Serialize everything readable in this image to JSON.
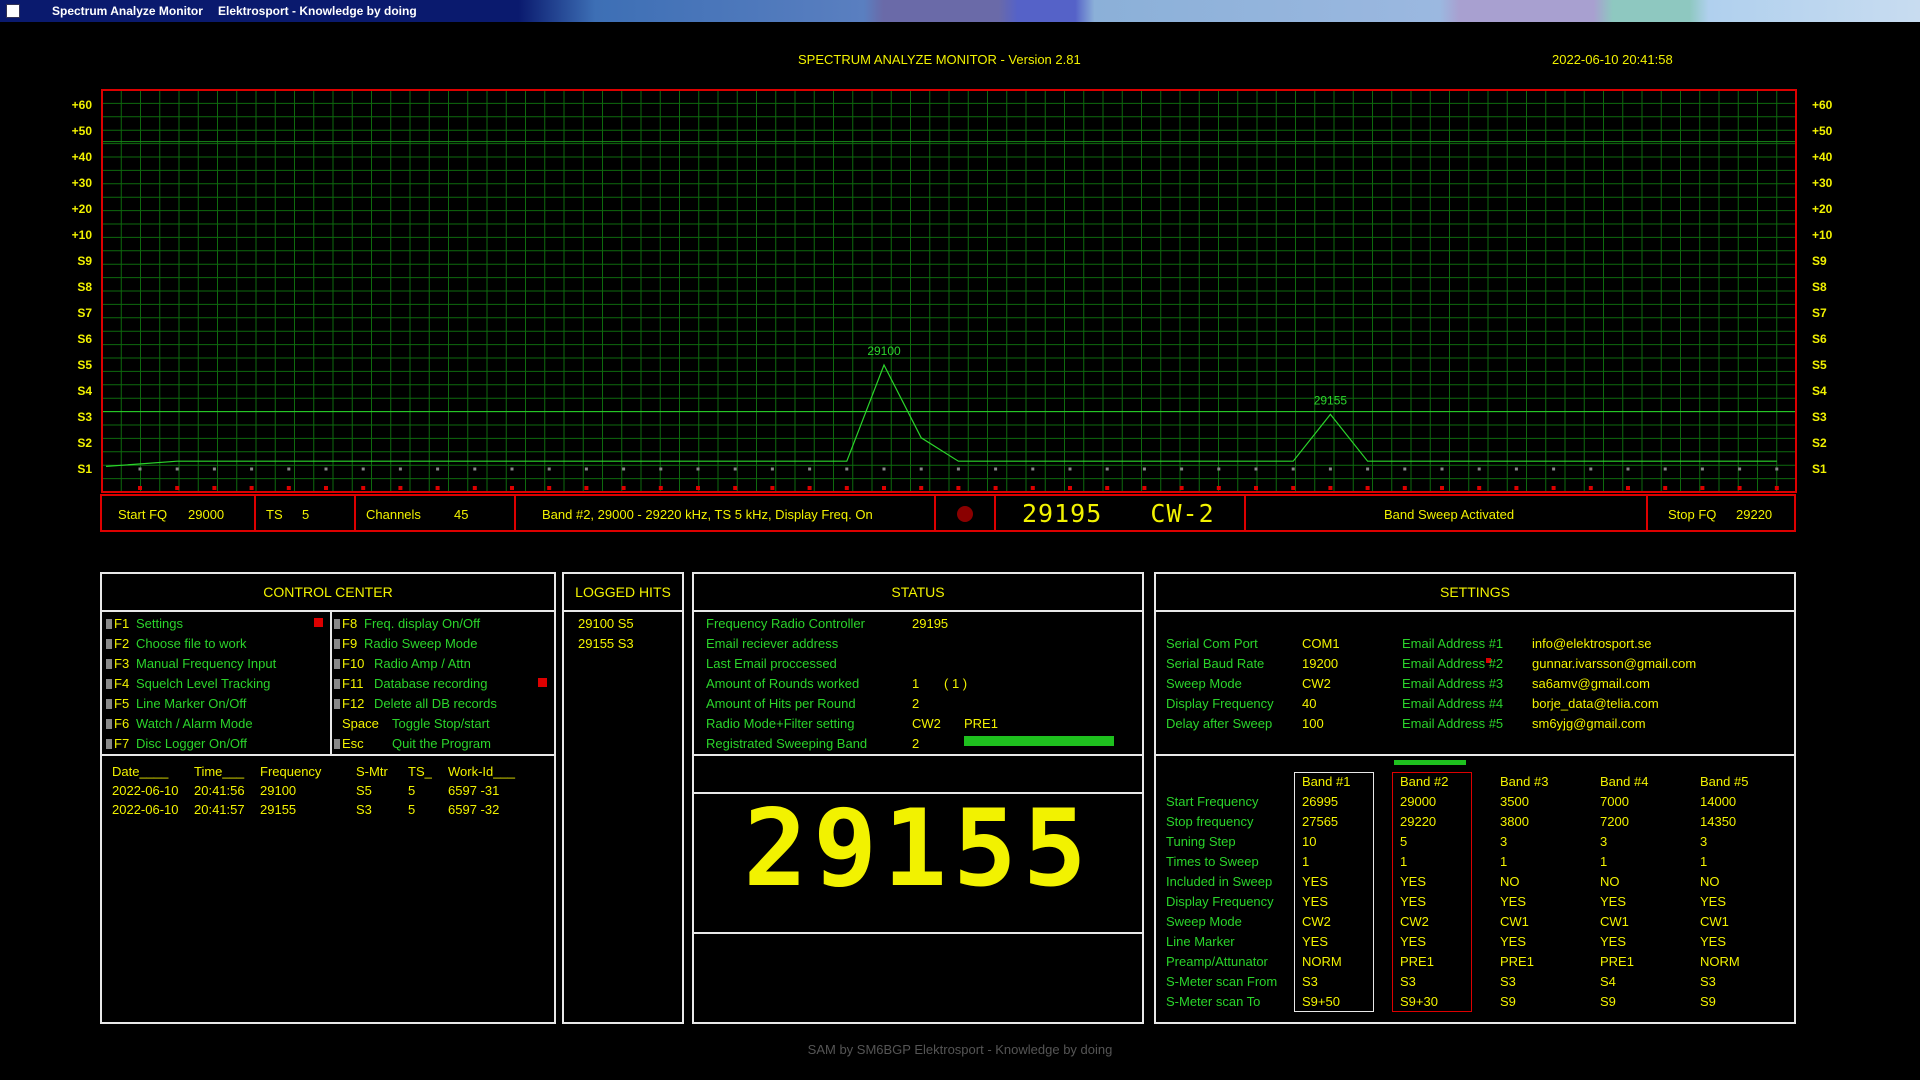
{
  "window": {
    "title": "Spectrum Analyze Monitor",
    "subtitle": "Elektrosport - Knowledge by doing"
  },
  "header": {
    "title": "SPECTRUM ANALYZE MONITOR - Version 2.81",
    "datetime": "2022-06-10 20:41:58"
  },
  "y_labels": [
    "+60",
    "+50",
    "+40",
    "+30",
    "+20",
    "+10",
    "S9",
    "S8",
    "S7",
    "S6",
    "S5",
    "S4",
    "S3",
    "S2",
    "S1"
  ],
  "peaks": [
    {
      "label": "29100"
    },
    {
      "label": "29155"
    }
  ],
  "chart_data": {
    "type": "line",
    "x_start": 29000,
    "x_step": 5,
    "x_end": 29220,
    "y_scale": [
      "S1",
      "S2",
      "S3",
      "S4",
      "S5",
      "S6",
      "S7",
      "S8",
      "S9",
      "+10",
      "+20",
      "+30",
      "+40",
      "+50",
      "+60"
    ],
    "series": [
      {
        "values": [
          0.1,
          0.3,
          0.3,
          0.3,
          0.3,
          0.3,
          0.3,
          0.3,
          0.3,
          0.3,
          0.3,
          0.3,
          0.3,
          0.3,
          0.3,
          0.3,
          0.3,
          0.3,
          0.3,
          0.3,
          4.0,
          1.2,
          0.3,
          0.3,
          0.3,
          0.3,
          0.3,
          0.3,
          0.3,
          0.3,
          0.3,
          0.3,
          2.1,
          0.3,
          0.3,
          0.3,
          0.3,
          0.3,
          0.3,
          0.3,
          0.3,
          0.3,
          0.3,
          0.3,
          0.3
        ]
      }
    ]
  },
  "infobar": {
    "start_label": "Start FQ",
    "start_value": "29000",
    "ts_label": "TS",
    "ts_value": "5",
    "channels_label": "Channels",
    "channels_value": "45",
    "band_info": "Band #2, 29000 - 29220 kHz, TS 5 kHz, Display Freq. On",
    "freq_mode": "29195   CW-2",
    "sweep_status": "Band Sweep Activated",
    "stop_label": "Stop FQ",
    "stop_value": "29220"
  },
  "control_center": {
    "title": "CONTROL CENTER",
    "left": [
      {
        "key": "F1",
        "label": "Settings"
      },
      {
        "key": "F2",
        "label": "Choose file to work"
      },
      {
        "key": "F3",
        "label": "Manual Frequency Input"
      },
      {
        "key": "F4",
        "label": "Squelch Level Tracking"
      },
      {
        "key": "F5",
        "label": "Line Marker On/Off"
      },
      {
        "key": "F6",
        "label": "Watch / Alarm Mode"
      },
      {
        "key": "F7",
        "label": "Disc Logger On/Off"
      }
    ],
    "right": [
      {
        "key": "F8",
        "label": "Freq. display On/Off"
      },
      {
        "key": "F9",
        "label": "Radio Sweep Mode"
      },
      {
        "key": "F10",
        "label": "Radio Amp / Attn"
      },
      {
        "key": "F11",
        "label": "Database recording"
      },
      {
        "key": "F12",
        "label": "Delete all DB records"
      },
      {
        "key": "Space",
        "label": "Toggle Stop/start"
      },
      {
        "key": "Esc",
        "label": "Quit the Program"
      }
    ]
  },
  "log_table": {
    "headers": [
      "Date____",
      "Time___",
      "Frequency",
      "S-Mtr",
      "TS_",
      "Work-Id___"
    ],
    "rows": [
      [
        "2022-06-10",
        "20:41:56",
        "29100",
        "S5",
        "5",
        "6597 -31"
      ],
      [
        "2022-06-10",
        "20:41:57",
        "29155",
        "S3",
        "5",
        "6597 -32"
      ]
    ]
  },
  "logged_hits": {
    "title": "LOGGED HITS",
    "items": [
      "29100 S5",
      "29155 S3"
    ]
  },
  "status": {
    "title": "STATUS",
    "rows": [
      {
        "label": "Frequency Radio Controller",
        "value": "29195",
        "extra": ""
      },
      {
        "label": "Email reciever address",
        "value": "",
        "extra": ""
      },
      {
        "label": "Last Email proccessed",
        "value": "",
        "extra": ""
      },
      {
        "label": "Amount of Rounds worked",
        "value": "1",
        "extra": "( 1 )"
      },
      {
        "label": "Amount of Hits per Round",
        "value": "2",
        "extra": ""
      },
      {
        "label": "Radio Mode+Filter setting",
        "value": "CW2",
        "extra": "PRE1"
      },
      {
        "label": "Registrated Sweeping Band",
        "value": "2",
        "extra": ""
      }
    ],
    "big_frequency": "29155"
  },
  "settings": {
    "title": "SETTINGS",
    "general": [
      {
        "label": "Serial Com Port",
        "value": "COM1"
      },
      {
        "label": "Serial Baud Rate",
        "value": "19200"
      },
      {
        "label": "Sweep Mode",
        "value": "CW2"
      },
      {
        "label": "Display Frequency",
        "value": "40"
      },
      {
        "label": "Delay after Sweep",
        "value": "100"
      }
    ],
    "emails": [
      {
        "label": "Email Address #1",
        "value": "info@elektrosport.se"
      },
      {
        "label": "Email Address #2",
        "value": "gunnar.ivarsson@gmail.com"
      },
      {
        "label": "Email Address #3",
        "value": "sa6amv@gmail.com"
      },
      {
        "label": "Email Address #4",
        "value": "borje_data@telia.com"
      },
      {
        "label": "Email Address #5",
        "value": "sm6yjg@gmail.com"
      }
    ],
    "band_headers": [
      "Band #1",
      "Band #2",
      "Band #3",
      "Band #4",
      "Band #5"
    ],
    "band_row_labels": [
      "Start Frequency",
      "Stop frequency",
      "Tuning Step",
      "Times to Sweep",
      "Included in Sweep",
      "Display Frequency",
      "Sweep Mode",
      "Line Marker",
      "Preamp/Attunator",
      "S-Meter scan From",
      "S-Meter scan To"
    ],
    "bands": [
      [
        "26995",
        "27565",
        "10",
        "1",
        "YES",
        "YES",
        "CW2",
        "YES",
        "NORM",
        "S3",
        "S9+50"
      ],
      [
        "29000",
        "29220",
        "5",
        "1",
        "YES",
        "YES",
        "CW2",
        "YES",
        "PRE1",
        "S3",
        "S9+30"
      ],
      [
        "3500",
        "3800",
        "3",
        "1",
        "NO",
        "YES",
        "CW1",
        "YES",
        "PRE1",
        "S3",
        "S9"
      ],
      [
        "7000",
        "7200",
        "3",
        "1",
        "NO",
        "YES",
        "CW1",
        "YES",
        "PRE1",
        "S4",
        "S9"
      ],
      [
        "14000",
        "14350",
        "3",
        "1",
        "NO",
        "YES",
        "CW1",
        "YES",
        "NORM",
        "S3",
        "S9"
      ]
    ]
  },
  "footer": "SAM by SM6BGP Elektrosport - Knowledge by doing",
  "colors": {
    "green": "#2bd42b",
    "yellow": "#f2f200",
    "red": "#d00000",
    "grid": "#0e6a0e"
  }
}
